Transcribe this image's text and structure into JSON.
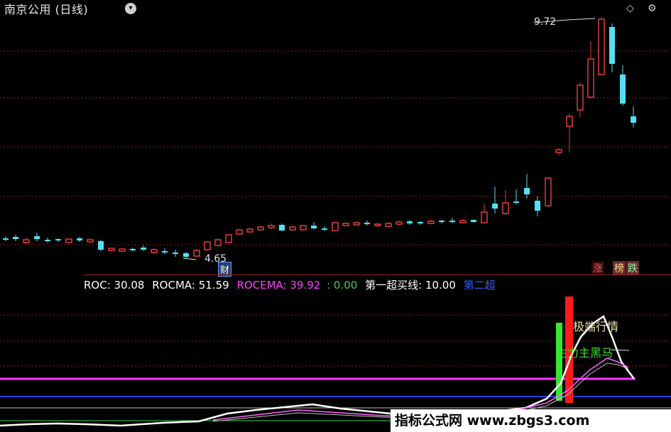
{
  "header": {
    "title": "南京公用 (日线)",
    "dropdown_icon": "chevron-down-icon",
    "diamond_icon": "diamond-icon",
    "gear_icon": "gear-icon"
  },
  "price_chart": {
    "high_label": "9.72",
    "low_label": "4.65",
    "finance_tag": "财",
    "tags": [
      "涨",
      "榜",
      "跌"
    ],
    "colors": {
      "up": "#e23b3b",
      "down": "#54e0f2",
      "grid": "#8b1c1c"
    }
  },
  "indicator": {
    "roc_label": "ROC: 30.08",
    "rocma_label": "ROCMA: 51.59",
    "rocema_label": "ROCEMA: 39.92",
    "zero_label": ": 0.00",
    "buy_line_label": "第一超买线: 10.00",
    "second_label": "第二超",
    "extreme_label": "极端行情",
    "main_label": "主力主黑马",
    "colors": {
      "roc": "#ffffff",
      "rocma": "#ffffff",
      "rocema": "#ff40ff",
      "zero": "#39d353",
      "buy": "#ffffff",
      "second": "#2f5bff",
      "magenta_line": "#ff33ff"
    }
  },
  "watermark": {
    "text": "指标公式网 www.zbgs3.com"
  }
}
